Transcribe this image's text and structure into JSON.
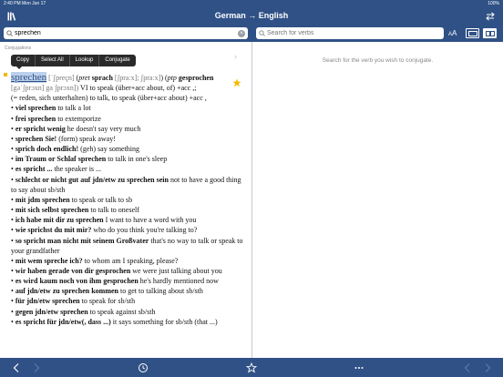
{
  "status": {
    "time": "2:40 PM  Mon Jun 17",
    "battery": "100%"
  },
  "nav": {
    "title": "German → English"
  },
  "search": {
    "query": "sprechen",
    "verbs_placeholder": "Search for verbs",
    "font_size_label": "A"
  },
  "left": {
    "section_label": "Conjugations",
    "context_menu": [
      "Copy",
      "Select All",
      "Lookup",
      "Conjugate"
    ]
  },
  "entry": {
    "headword": "sprechen",
    "pron": " [ˈʃpreçn] ",
    "head_rest_1": "(",
    "pret_label": "pret",
    "pret": " sprach ",
    "pret_pron": "[ʃpraːx]; ʃpraːx]",
    "head_rest_2": ") (",
    "ptp_label": "ptp",
    "ptp": " gesprochen",
    "line2_grey": "[gəˈʃprɔxn] ga ʃprɔxn])",
    "line2": " VI to speak (über+acc about, of) +acc ,;",
    "line3": "(= reden, sich unterhalten) to talk, to speak (über+acc about) +acc ,",
    "senses": [
      {
        "de": "viel sprechen",
        "en": " to talk a lot"
      },
      {
        "de": "frei sprechen",
        "en": " to extemporize"
      },
      {
        "de": "er spricht wenig",
        "en": " he doesn't say very much"
      },
      {
        "de": "sprechen Sie!",
        "en": " (form) speak away!"
      },
      {
        "de": "sprich doch endlich!",
        "en": " (geh) say something"
      },
      {
        "de": "im Traum or Schlaf sprechen",
        "en": " to talk in one's sleep"
      },
      {
        "de": "es spricht ...",
        "en": " the speaker is ..."
      },
      {
        "de": "schlecht or nicht gut auf jdn/etw zu sprechen sein",
        "en": " not to have a good thing to say about sb/sth"
      },
      {
        "de": "mit jdm sprechen",
        "en": " to speak or talk to sb"
      },
      {
        "de": "mit sich selbst sprechen",
        "en": " to talk to oneself"
      },
      {
        "de": "ich habe mit dir zu sprechen",
        "en": " I want to have a word with you"
      },
      {
        "de": "wie sprichst du mit mir?",
        "en": " who do you think you're talking to?"
      },
      {
        "de": "so spricht man nicht mit seinem Großvater",
        "en": " that's no way to talk or speak to your grandfather"
      },
      {
        "de": "mit wem spreche ich?",
        "en": " to whom am I speaking, please?"
      },
      {
        "de": "wir haben gerade von dir gesprochen",
        "en": " we were just talking about you"
      },
      {
        "de": "es wird kaum noch von ihm gesprochen",
        "en": " he's hardly mentioned now"
      },
      {
        "de": "auf jdn/etw zu sprechen kommen",
        "en": " to get to talking about sb/sth"
      },
      {
        "de": "für jdn/etw sprechen",
        "en": " to speak for sb/sth"
      },
      {
        "de": "gegen jdn/etw sprechen",
        "en": " to speak against sb/sth"
      },
      {
        "de": "es spricht für jdn/etw(, dass ...)",
        "en": " it says something for sb/sth (that ...)"
      }
    ]
  },
  "right": {
    "hint": "Search for the verb you wish to conjugate."
  },
  "colors": {
    "bar": "#2f5185",
    "highlight": "#bcd0ec",
    "star": "#f5b800"
  }
}
